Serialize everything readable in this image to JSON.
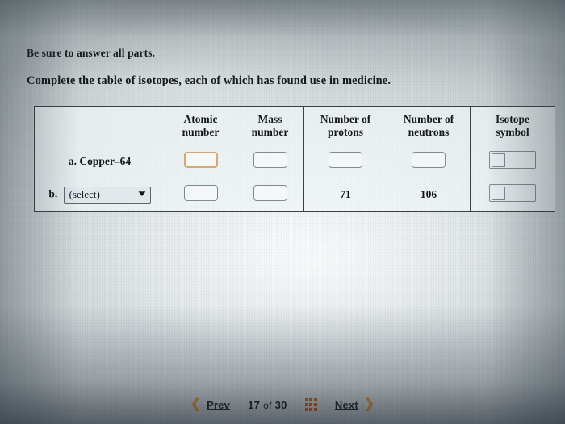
{
  "question": {
    "instruction": "Be sure to answer all parts.",
    "prompt": "Complete the table of isotopes, each of which has found use in medicine."
  },
  "table": {
    "headers": [
      "",
      "Atomic number",
      "Mass number",
      "Number of protons",
      "Number of neutrons",
      "Isotope symbol"
    ],
    "header_lines": {
      "blank": "",
      "atomic_number_l1": "Atomic",
      "atomic_number_l2": "number",
      "mass_number_l1": "Mass",
      "mass_number_l2": "number",
      "protons_l1": "Number of",
      "protons_l2": "protons",
      "neutrons_l1": "Number of",
      "neutrons_l2": "neutrons",
      "isotope_l1": "Isotope",
      "isotope_l2": "symbol"
    },
    "rows": [
      {
        "marker": "a.",
        "label": "a. Copper–64",
        "label_type": "text",
        "atomic_number": {
          "type": "input",
          "value": "",
          "focused": true
        },
        "mass_number": {
          "type": "input",
          "value": "",
          "focused": false
        },
        "protons": {
          "type": "input",
          "value": "",
          "focused": false
        },
        "neutrons": {
          "type": "input",
          "value": "",
          "focused": false
        },
        "isotope_symbol": {
          "type": "symbol-widget",
          "value": ""
        }
      },
      {
        "marker": "b.",
        "label": "b.",
        "label_type": "select",
        "select_value": "(select)",
        "select_caret": "⌄",
        "atomic_number": {
          "type": "input",
          "value": "",
          "focused": false
        },
        "mass_number": {
          "type": "input",
          "value": "",
          "focused": false
        },
        "protons": {
          "type": "value",
          "value": "71"
        },
        "neutrons": {
          "type": "value",
          "value": "106"
        },
        "isotope_symbol": {
          "type": "symbol-widget",
          "value": ""
        }
      }
    ]
  },
  "navigation": {
    "prev_label": "Prev",
    "prev_chevron": "❮",
    "next_label": "Next",
    "next_chevron": "❯",
    "current_page": "17",
    "of_word": "of",
    "total_pages": "30",
    "grid_icon": "grid-icon"
  },
  "colors": {
    "accent_orange": "#e0912f",
    "grid_icon_orange": "#d2590f",
    "focused_input_border": "#d9a772",
    "input_border": "#7f8b92",
    "table_border": "#3b4044",
    "text": "#15181b"
  }
}
